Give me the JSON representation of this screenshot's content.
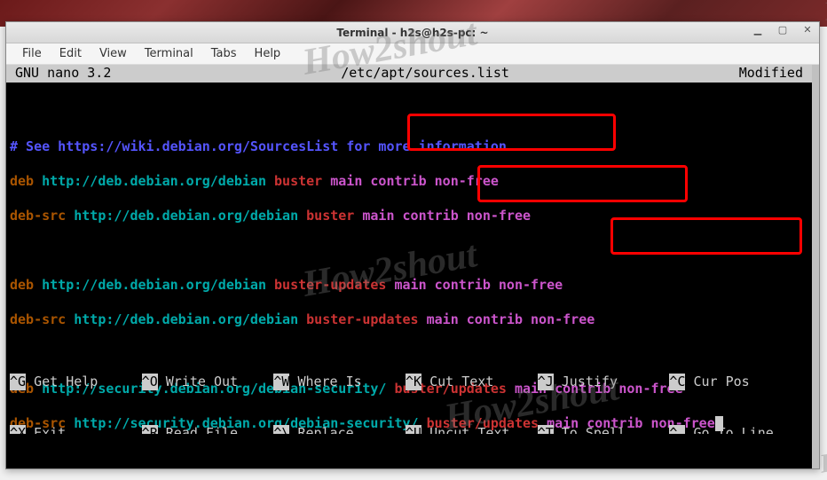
{
  "window": {
    "title": "Terminal - h2s@h2s-pc: ~"
  },
  "menubar": {
    "file": "File",
    "edit": "Edit",
    "view": "View",
    "terminal": "Terminal",
    "tabs": "Tabs",
    "help": "Help"
  },
  "nano": {
    "version": "GNU nano 3.2",
    "filename": "/etc/apt/sources.list",
    "status": "Modified"
  },
  "content": {
    "comment": "# See https://wiki.debian.org/SourcesList for more information.",
    "lines": [
      {
        "type": "deb",
        "url": "http://deb.debian.org/debian",
        "suite": "buster",
        "comp1": "main",
        "comp2": "contrib non-free"
      },
      {
        "type": "deb-src",
        "url": "http://deb.debian.org/debian",
        "suite": "buster",
        "comp1": "main",
        "comp2": "contrib non-free"
      },
      {
        "type": "deb",
        "url": "http://deb.debian.org/debian",
        "suite": "buster-updates",
        "comp1": "main",
        "comp2": "contrib non-free"
      },
      {
        "type": "deb-src",
        "url": "http://deb.debian.org/debian",
        "suite": "buster-updates",
        "comp1": "main",
        "comp2": "contrib non-free"
      },
      {
        "type": "deb",
        "url": "http://security.debian.org/debian-security/",
        "suite": "buster/updates",
        "comp1": "main",
        "comp2": "contrib non-free"
      },
      {
        "type": "deb-src",
        "url": "http://security.debian.org/debian-security/",
        "suite": "buster/updates",
        "comp1": "main",
        "comp2": "contrib non-free"
      }
    ]
  },
  "shortcuts": {
    "row1": [
      {
        "key": "^G",
        "label": "Get Help"
      },
      {
        "key": "^O",
        "label": "Write Out"
      },
      {
        "key": "^W",
        "label": "Where Is"
      },
      {
        "key": "^K",
        "label": "Cut Text"
      },
      {
        "key": "^J",
        "label": "Justify"
      },
      {
        "key": "^C",
        "label": "Cur Pos"
      }
    ],
    "row2": [
      {
        "key": "^X",
        "label": "Exit"
      },
      {
        "key": "^R",
        "label": "Read File"
      },
      {
        "key": "^\\",
        "label": "Replace"
      },
      {
        "key": "^U",
        "label": "Uncut Text"
      },
      {
        "key": "^T",
        "label": "To Spell"
      },
      {
        "key": "^_",
        "label": "Go To Line"
      }
    ]
  },
  "watermark": "How2shout"
}
